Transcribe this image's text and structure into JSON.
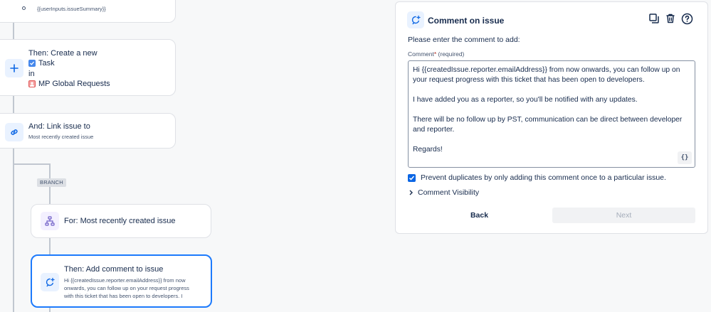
{
  "flow": {
    "top_card": {
      "summary_var": "{{userInputs.issueSummary}}"
    },
    "create_card": {
      "title": "Then: Create a new",
      "issue_type": "Task",
      "in_label": "in",
      "project": "MP Global Requests"
    },
    "link_card": {
      "title": "And: Link issue to",
      "subtitle": "Most recently created issue"
    },
    "branch_label": "BRANCH",
    "for_card": {
      "title": "For: Most recently created issue"
    },
    "comment_card": {
      "title": "Then: Add comment to issue",
      "line1": "Hi {{createdIssue.reporter.emailAddress}} from now",
      "line2": "onwards, you can follow up on your request progress",
      "line3": "with this ticket that has been open to developers. I"
    }
  },
  "panel": {
    "title": "Comment on issue",
    "prompt": "Please enter the comment to add:",
    "field_label": "Comment",
    "required_mark": "*",
    "required_text": "(required)",
    "comment_paragraphs": [
      "Hi {{createdIssue.reporter.emailAddress}} from now onwards, you can follow up on your request progress with this ticket that has been open to developers.",
      "I have added you as a reporter, so you'll be notified with any updates.",
      "There will be no follow up by PST, communication can be direct between developer and reporter.",
      "Regards!"
    ],
    "code_button": "{}",
    "prevent_duplicates": "Prevent duplicates by only adding this comment once to a particular issue.",
    "visibility_label": "Comment Visibility",
    "back_label": "Back",
    "next_label": "Next"
  },
  "icons": {
    "panel_icon": "comment-add-icon",
    "tools": [
      "duplicate-icon",
      "trash-icon",
      "help-icon"
    ]
  },
  "colors": {
    "accent": "#0c66e4",
    "selected_border": "#1d7afc",
    "task_blue": "#4688ec"
  }
}
